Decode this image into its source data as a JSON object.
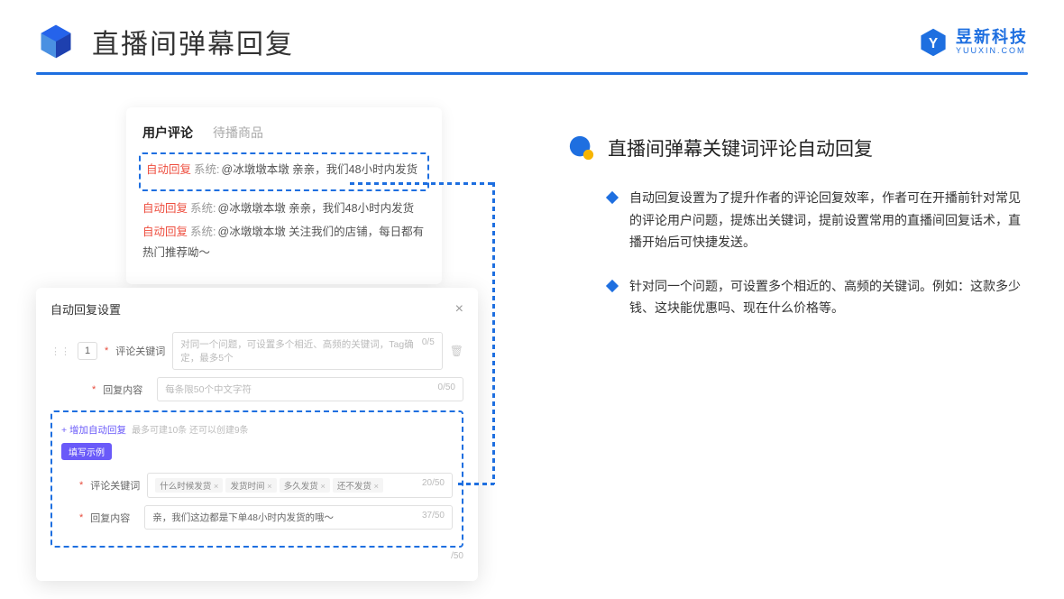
{
  "header": {
    "title": "直播间弹幕回复",
    "brand_cn": "昱新科技",
    "brand_en": "YUUXIN.COM"
  },
  "comments": {
    "tab_active": "用户评论",
    "tab_inactive": "待播商品",
    "rows": [
      {
        "tag": "自动回复",
        "sys": "系统:",
        "text": "@冰墩墩本墩 亲亲，我们48小时内发货"
      },
      {
        "tag": "自动回复",
        "sys": "系统:",
        "text": "@冰墩墩本墩 亲亲，我们48小时内发货"
      },
      {
        "tag": "自动回复",
        "sys": "系统:",
        "text": "@冰墩墩本墩 关注我们的店铺，每日都有热门推荐呦～"
      }
    ]
  },
  "modal": {
    "title": "自动回复设置",
    "num": "1",
    "field1_label": "评论关键词",
    "field1_ph": "对同一个问题，可设置多个相近、高频的关键词，Tag确定，最多5个",
    "field1_counter": "0/5",
    "field2_label": "回复内容",
    "field2_ph": "每条限50个中文字符",
    "field2_counter": "0/50",
    "add_link": "+ 增加自动回复",
    "add_hint": "最多可建10条 还可以创建9条",
    "pill": "填写示例",
    "ex_kw_label": "评论关键词",
    "ex_kw_tags": [
      "什么时候发货",
      "发货时间",
      "多久发货",
      "还不发货"
    ],
    "ex_kw_counter": "20/50",
    "ex_reply_label": "回复内容",
    "ex_reply_text": "亲，我们这边都是下单48小时内发货的哦～",
    "ex_reply_counter": "37/50",
    "outer_counter": "/50"
  },
  "right": {
    "section_title": "直播间弹幕关键词评论自动回复",
    "bullets": [
      "自动回复设置为了提升作者的评论回复效率，作者可在开播前针对常见的评论用户问题，提炼出关键词，提前设置常用的直播间回复话术，直播开始后可快捷发送。",
      "针对同一个问题，可设置多个相近的、高频的关键词。例如：这款多少钱、这块能优惠吗、现在什么价格等。"
    ]
  }
}
